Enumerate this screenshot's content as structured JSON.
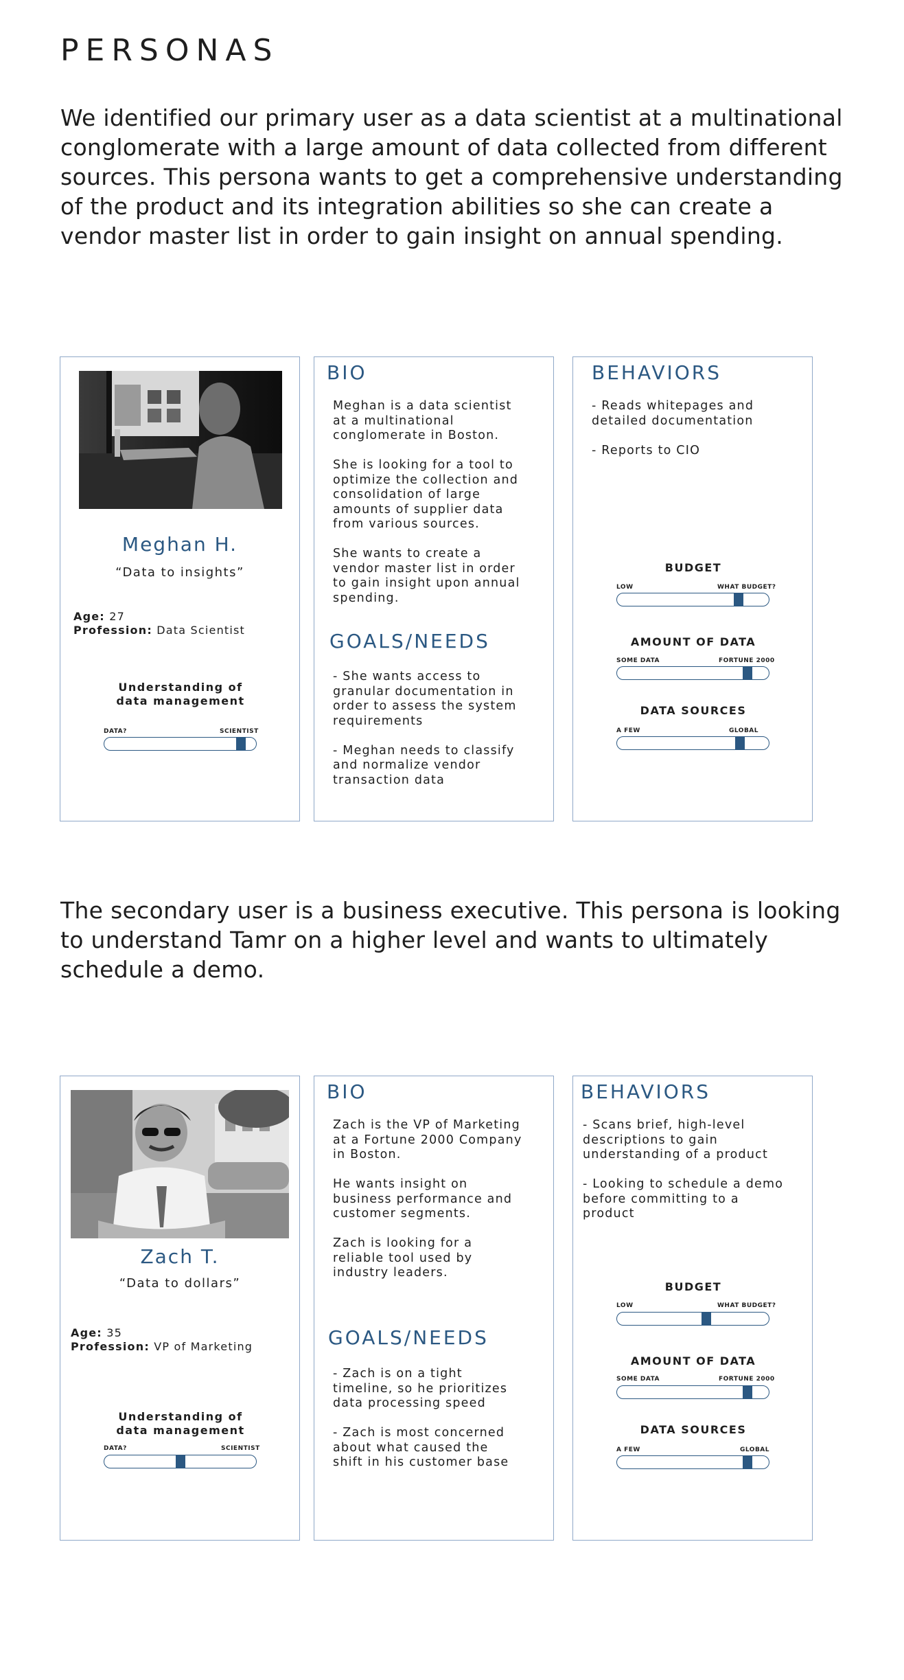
{
  "page": {
    "title": "PERSONAS",
    "intro_primary": "We identified our primary user as a data scientist at a multinational conglomerate with a large amount of data collected from different sources. This persona wants to get a comprehensive understanding of the product and its integration abilities so she can create a vendor master list in order to gain insight on annual spending.",
    "intro_secondary": "The secondary user is a business executive. This persona is looking to understand Tamr on a higher level and wants to ultimately schedule a demo."
  },
  "colors": {
    "accent": "#2b5882",
    "border": "#8fa8c8"
  },
  "personas": [
    {
      "name": "Meghan H.",
      "quote": "“Data to insights”",
      "age_label": "Age:",
      "age": "27",
      "profession_label": "Profession:",
      "profession": "Data Scientist",
      "understanding": {
        "label": "Understanding of\ndata management",
        "low": "DATA?",
        "high": "SCIENTIST",
        "level": 0.9
      },
      "bio_heading": "BIO",
      "bio": "Meghan is a data scientist\nat a multinational\nconglomerate in Boston.\n\nShe is looking for a tool to\noptimize the collection and\nconsolidation of large\namounts of supplier data\nfrom various sources.\n\nShe wants to create a\nvendor master list in order\nto gain insight upon annual\nspending.",
      "goals_heading": "GOALS/NEEDS",
      "goals": "- She wants access to\ngranular documentation in\norder to assess the system\nrequirements\n\n- Meghan needs to classify\nand normalize vendor\ntransaction data",
      "behaviors_heading": "BEHAVIORS",
      "behaviors": "- Reads whitepages and\ndetailed documentation\n\n- Reports to CIO",
      "sliders": [
        {
          "label": "BUDGET",
          "low": "LOW",
          "high": "WHAT BUDGET?",
          "level": 0.8
        },
        {
          "label": "AMOUNT OF DATA",
          "low": "SOME DATA",
          "high": "FORTUNE 2000",
          "level": 0.86
        },
        {
          "label": "DATA SOURCES",
          "low": "A FEW",
          "high": "GLOBAL",
          "level": 0.81
        }
      ]
    },
    {
      "name": "Zach T.",
      "quote": "“Data to dollars”",
      "age_label": "Age:",
      "age": "35",
      "profession_label": "Profession:",
      "profession": "VP of Marketing",
      "understanding": {
        "label": "Understanding of\ndata management",
        "low": "DATA?",
        "high": "SCIENTIST",
        "level": 0.5
      },
      "bio_heading": "BIO",
      "bio": "Zach is the VP of Marketing\nat a Fortune 2000 Company\nin Boston.\n\nHe wants insight on\nbusiness performance and\ncustomer segments.\n\nZach is looking for a\nreliable tool used by\nindustry leaders.",
      "goals_heading": "GOALS/NEEDS",
      "goals": "- Zach is on a tight\ntimeline, so he prioritizes\ndata processing speed\n\n- Zach is most concerned\nabout what caused the\nshift in his customer base",
      "behaviors_heading": "BEHAVIORS",
      "behaviors": "- Scans brief, high-level\ndescriptions to gain\nunderstanding of a product\n\n- Looking to schedule a demo\nbefore committing to a\nproduct",
      "sliders": [
        {
          "label": "BUDGET",
          "low": "LOW",
          "high": "WHAT BUDGET?",
          "level": 0.59
        },
        {
          "label": "AMOUNT OF DATA",
          "low": "SOME DATA",
          "high": "FORTUNE 2000",
          "level": 0.86
        },
        {
          "label": "DATA SOURCES",
          "low": "A FEW",
          "high": "GLOBAL",
          "level": 0.86
        }
      ]
    }
  ]
}
